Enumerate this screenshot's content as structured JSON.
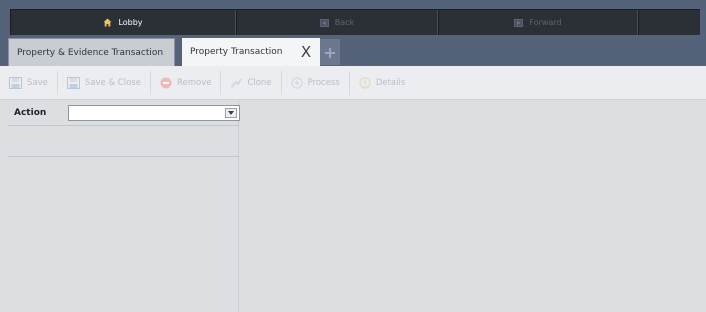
{
  "topnav": {
    "lobby_label": "Lobby",
    "back_label": "Back",
    "forward_label": "Forward",
    "lobby_icon": "home-icon",
    "back_icon": "back-icon",
    "forward_icon": "forward-icon"
  },
  "tabs": [
    {
      "label": "Property & Evidence Transaction",
      "active": false
    },
    {
      "label": "Property Transaction",
      "active": true
    }
  ],
  "tab_close_label": "X",
  "tab_add_icon": "plus-icon",
  "toolbar": {
    "items": [
      {
        "label": "Save",
        "icon": "save-icon"
      },
      {
        "label": "Save & Close",
        "icon": "save-close-icon"
      },
      {
        "label": "Remove",
        "icon": "remove-icon"
      },
      {
        "label": "Clone",
        "icon": "clone-icon"
      },
      {
        "label": "Process",
        "icon": "process-icon"
      },
      {
        "label": "Details",
        "icon": "details-icon"
      }
    ]
  },
  "form": {
    "action_label": "Action",
    "action_value": ""
  },
  "colors": {
    "nav_background": "#2b2f36",
    "frame_background": "#54627a",
    "active_tab": "#f4f5f7",
    "panel_background": "#dcdfe2",
    "disabled_text": "#b9bec6"
  }
}
